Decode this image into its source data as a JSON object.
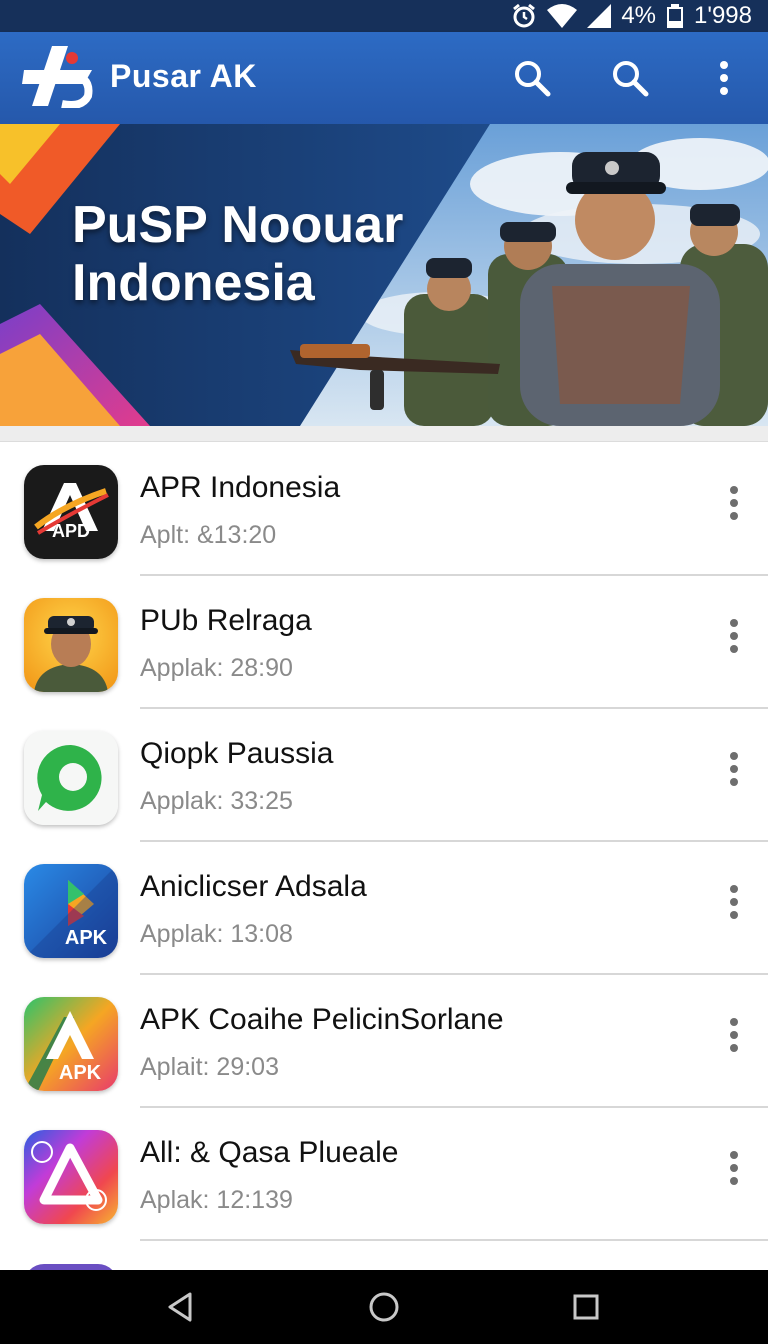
{
  "status_bar": {
    "battery": "4%",
    "time": "1'998",
    "icons": [
      "alarm-icon",
      "wifi-icon",
      "signal-icon",
      "battery-icon"
    ]
  },
  "app_bar": {
    "title": "Pusar AK",
    "actions": [
      "search-icon",
      "search-icon",
      "more-vert-icon"
    ],
    "color": "#2a63b8"
  },
  "banner": {
    "line1": "PuSP Noouar",
    "line2": "Indonesia"
  },
  "apps": [
    {
      "name": "APR Indonesia",
      "sub": "Aplt: &13:20",
      "icon": "apd-icon",
      "icon_text": "APD"
    },
    {
      "name": "PUb Relraga",
      "sub": "Applak: 28:90",
      "icon": "soldier-portrait-icon",
      "icon_text": ""
    },
    {
      "name": "Qiopk Paussia",
      "sub": "Applak: 33:25",
      "icon": "green-chat-bubble-icon",
      "icon_text": ""
    },
    {
      "name": "Aniclicser Adsala",
      "sub": "Applak: 13:08",
      "icon": "apk-play-icon",
      "icon_text": "APK"
    },
    {
      "name": "APK Coaihe PelicinSorlane",
      "sub": "Aplait: 29:03",
      "icon": "apk-gradient-icon",
      "icon_text": "APK"
    },
    {
      "name": "All: & Qasa Plueale",
      "sub": "Aplak: 12:139",
      "icon": "colorful-triangle-icon",
      "icon_text": ""
    }
  ],
  "nav_bar": [
    "back-icon",
    "home-icon",
    "recents-icon"
  ]
}
